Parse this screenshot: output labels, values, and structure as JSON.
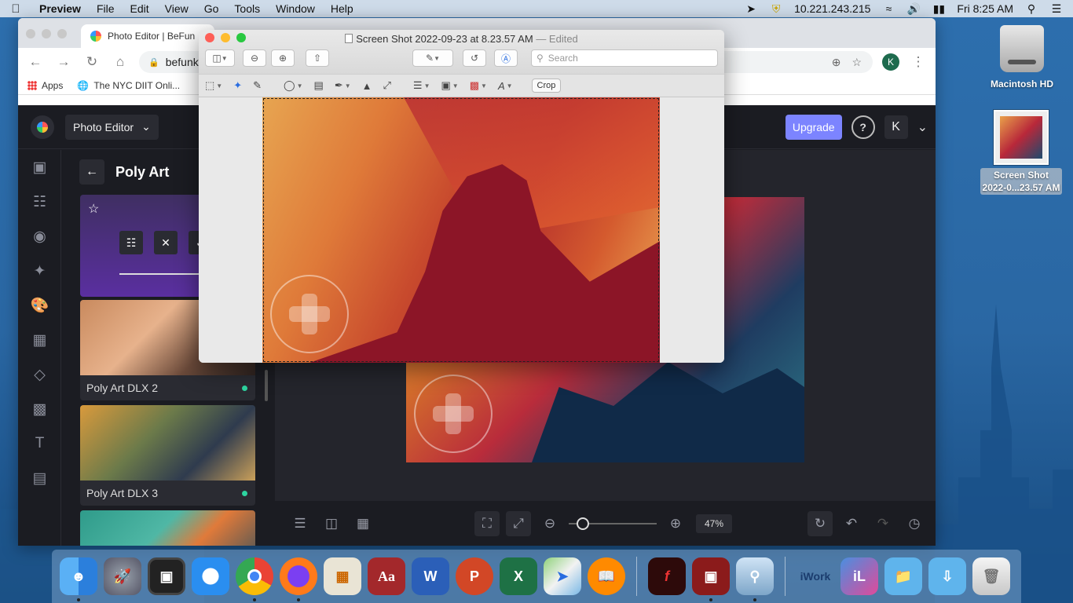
{
  "menubar": {
    "app_name": "Preview",
    "menus": [
      "File",
      "Edit",
      "View",
      "Go",
      "Tools",
      "Window",
      "Help"
    ],
    "ip_address": "10.221.243.215",
    "clock": "Fri 8:25 AM"
  },
  "desktop": {
    "hd_label": "Macintosh HD",
    "screenshot_label_line1": "Screen Shot",
    "screenshot_label_line2": "2022-0...23.57 AM"
  },
  "chrome": {
    "tab_title": "Photo Editor | BeFun",
    "url": "befunky.",
    "profile_initial": "K",
    "bookmarks": [
      "Apps",
      "The NYC DIIT Onli..."
    ]
  },
  "befunky": {
    "mode_label": "Photo Editor",
    "upgrade_label": "Upgrade",
    "help_label": "?",
    "account_initial": "K",
    "panel_title": "Poly Art",
    "effects": [
      {
        "label": "Poly Art DLX 2",
        "is_new": true
      },
      {
        "label": "Poly Art DLX 3",
        "is_new": true
      }
    ],
    "zoom_value": "47%",
    "zoom_level": 0.1
  },
  "preview": {
    "window_title": "Screen Shot 2022-09-23 at 8.23.57 AM",
    "edited_suffix": "— Edited",
    "search_placeholder": "Search",
    "crop_label": "Crop"
  },
  "dock": {
    "apps": [
      "finder",
      "launchpad",
      "photo-booth-app",
      "safari",
      "chrome",
      "firefox",
      "calculator",
      "dictionary",
      "word",
      "powerpoint",
      "excel",
      "maps",
      "ibooks",
      "flash",
      "photo-booth",
      "preview",
      "iwork",
      "ilife",
      "folder",
      "downloads",
      "trash"
    ]
  }
}
